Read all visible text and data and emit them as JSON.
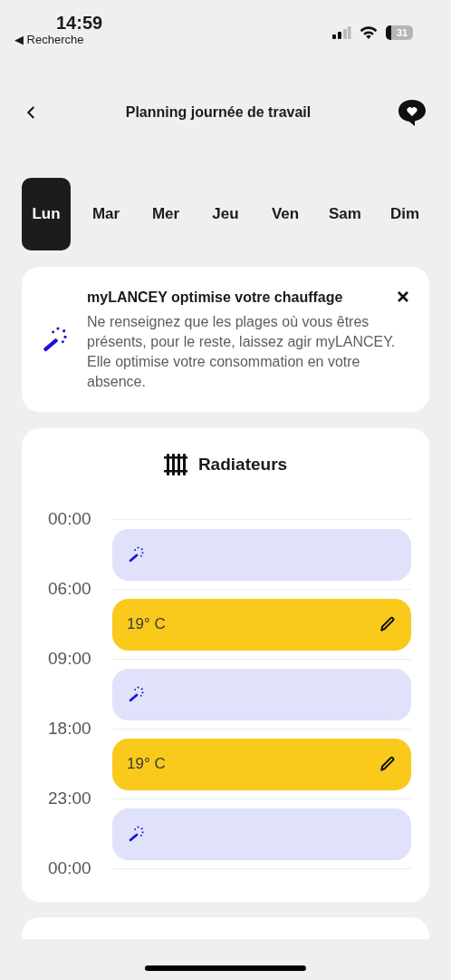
{
  "status_bar": {
    "time": "14:59",
    "back_label": "◀ Recherche",
    "battery": "31"
  },
  "header": {
    "title": "Planning journée de travail"
  },
  "days": [
    {
      "label": "Lun",
      "selected": true
    },
    {
      "label": "Mar",
      "selected": false
    },
    {
      "label": "Mer",
      "selected": false
    },
    {
      "label": "Jeu",
      "selected": false
    },
    {
      "label": "Ven",
      "selected": false
    },
    {
      "label": "Sam",
      "selected": false
    },
    {
      "label": "Dim",
      "selected": false
    }
  ],
  "info_card": {
    "title": "myLANCEY optimise votre chauffage",
    "text": "Ne renseignez que les plages où vous êtres présents, pour le reste, laissez agir myLANCEY. Elle optimise votre consommation en votre absence."
  },
  "schedule": {
    "title": "Radiateurs",
    "times": [
      "00:00",
      "06:00",
      "09:00",
      "18:00",
      "23:00",
      "00:00"
    ],
    "slots": [
      {
        "kind": "auto"
      },
      {
        "kind": "temperature",
        "label": "19° C"
      },
      {
        "kind": "auto"
      },
      {
        "kind": "temperature",
        "label": "19° C"
      },
      {
        "kind": "auto"
      }
    ]
  }
}
